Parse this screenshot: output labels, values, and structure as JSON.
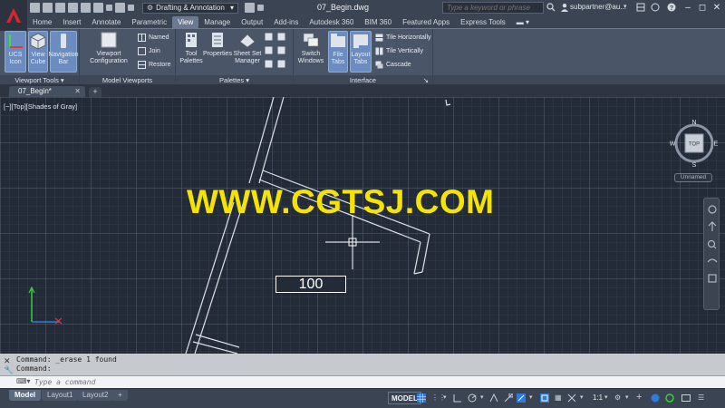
{
  "title_bar": {
    "workspace": "Drafting & Annotation",
    "document_title": "07_Begin.dwg",
    "search_placeholder": "Type a keyword or phrase",
    "user": "subpartner@au..."
  },
  "ribbon_tabs": [
    "Home",
    "Insert",
    "Annotate",
    "Parametric",
    "View",
    "Manage",
    "Output",
    "Add-ins",
    "Autodesk 360",
    "BIM 360",
    "Featured Apps",
    "Express Tools"
  ],
  "active_ribbon_tab": "View",
  "ribbon": {
    "viewport_tools": {
      "label": "Viewport Tools",
      "buttons": [
        "UCS Icon",
        "View Cube",
        "Navigation Bar"
      ]
    },
    "model_viewports": {
      "label": "Model Viewports",
      "config_button": "Viewport Configuration",
      "named": "Named",
      "join": "Join",
      "restore": "Restore"
    },
    "palettes": {
      "label": "Palettes",
      "buttons": [
        "Tool Palettes",
        "Properties",
        "Sheet Set Manager"
      ]
    },
    "interface": {
      "label": "Interface",
      "switch_windows": "Switch Windows",
      "file_tabs": "File Tabs",
      "layout_tabs": "Layout Tabs",
      "tile_horizontally": "Tile Horizontally",
      "tile_vertically": "Tile Vertically",
      "cascade": "Cascade"
    }
  },
  "file_tab": "07_Begin*",
  "drawing": {
    "viewport_label": "[−][Top][Shades of Gray]",
    "watermark": "WWW.CGTSJ.COM",
    "dimension_value": "100",
    "viewcube": {
      "n": "N",
      "s": "S",
      "e": "E",
      "w": "W",
      "face": "TOP"
    },
    "view_name": "Unnamed"
  },
  "command": {
    "history": [
      "Command:  _erase 1 found",
      "Command:"
    ],
    "input_placeholder": "Type a command"
  },
  "status": {
    "layout_tabs": [
      "Model",
      "Layout1",
      "Layout2"
    ],
    "model_button": "MODEL",
    "annotation_scale": "1:1"
  }
}
